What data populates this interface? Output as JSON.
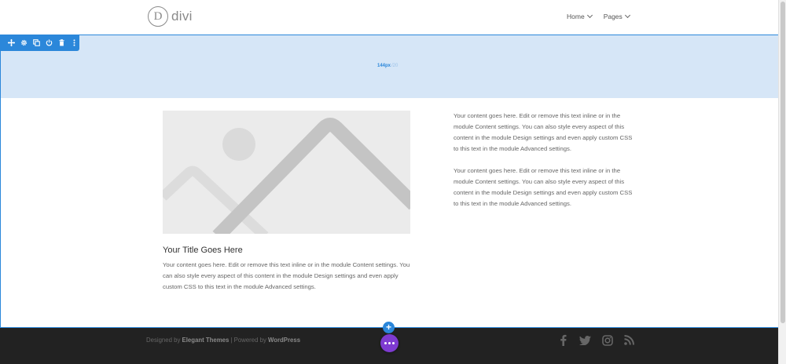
{
  "header": {
    "logo_mark": "D",
    "logo_text": "divi",
    "nav": [
      {
        "label": "Home"
      },
      {
        "label": "Pages"
      }
    ]
  },
  "builder": {
    "section_padding_value": "144px",
    "section_padding_unit": "/20",
    "toolbar_icons": [
      "move-icon",
      "gear-icon",
      "duplicate-icon",
      "power-icon",
      "trash-icon",
      "more-icon"
    ],
    "accent_color": "#2b87da",
    "menu_color": "#7e3bd0"
  },
  "content": {
    "blurb_title": "Your Title Goes Here",
    "blurb_text": "Your content goes here. Edit or remove this text inline or in the module Content settings. You can also style every aspect of this content in the module Design settings and even apply custom CSS to this text in the module Advanced settings.",
    "text_1": "Your content goes here. Edit or remove this text inline or in the module Content settings. You can also style every aspect of this content in the module Design settings and even apply custom CSS to this text in the module Advanced settings.",
    "text_2": "Your content goes here. Edit or remove this text inline or in the module Content settings. You can also style every aspect of this content in the module Design settings and even apply custom CSS to this text in the module Advanced settings."
  },
  "footer": {
    "designed_by_prefix": "Designed by ",
    "designed_by_link": "Elegant Themes",
    "separator": " | Powered by ",
    "powered_by_link": "WordPress",
    "social_icons": [
      "facebook-icon",
      "twitter-icon",
      "instagram-icon",
      "rss-icon"
    ]
  },
  "add_row_symbol": "+"
}
